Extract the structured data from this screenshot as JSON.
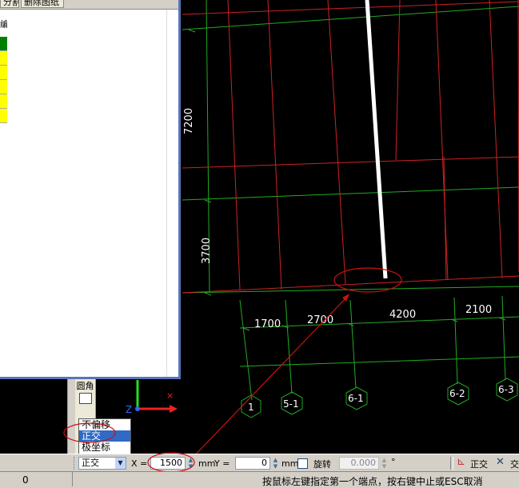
{
  "panel": {
    "buttons": [
      "分割",
      "删除图纸"
    ],
    "header_label": "编",
    "swatches": [
      "#008000",
      "#ffff00",
      "#ffff00",
      "#ffff00",
      "#ffff00",
      "#ffff00"
    ]
  },
  "drawing": {
    "vertical_dims": [
      "7200",
      "3700"
    ],
    "horizontal_dims": [
      "1700",
      "2700",
      "4200",
      "2100"
    ],
    "axis_labels": [
      "1",
      "5-1",
      "6-1",
      "6-2",
      "6-3"
    ],
    "ucs_label": "Z"
  },
  "toolstrip": {
    "label": "圆角"
  },
  "mode_dropdown": {
    "options": [
      "不偏移",
      "正交",
      "极坐标"
    ],
    "selected_index": 1
  },
  "toolbar": {
    "mode_value": "正交",
    "x_label": "X =",
    "x_value": "1500",
    "x_unit": "mm",
    "y_label": "Y =",
    "y_value": "0",
    "y_unit": "mm",
    "rotate_label": "旋转",
    "rotate_value": "0.000",
    "degree_symbol": "°",
    "ortho_label": "正交",
    "intersect_label": "交"
  },
  "status": {
    "coord": "0",
    "prompt": "按鼠标左键指定第一个端点，按右键中止或ESC取消"
  }
}
